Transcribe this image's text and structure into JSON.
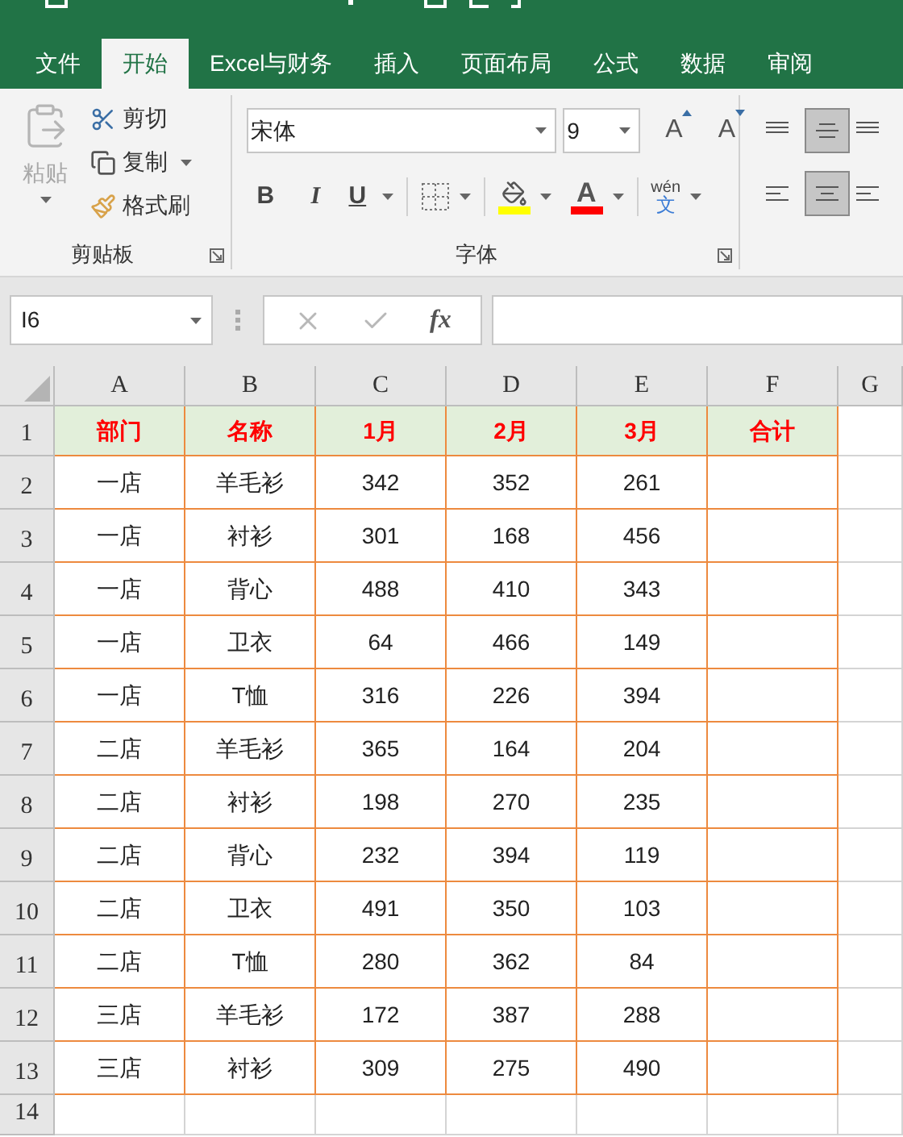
{
  "ribbon_tabs": [
    {
      "label": "文件",
      "selected": false
    },
    {
      "label": "开始",
      "selected": true
    },
    {
      "label": "Excel与财务",
      "selected": false
    },
    {
      "label": "插入",
      "selected": false
    },
    {
      "label": "页面布局",
      "selected": false
    },
    {
      "label": "公式",
      "selected": false
    },
    {
      "label": "数据",
      "selected": false
    },
    {
      "label": "审阅",
      "selected": false
    }
  ],
  "clipboard": {
    "paste": {
      "label": "粘贴",
      "disabled": true
    },
    "cut": "剪切",
    "copy": "复制",
    "format_painter": "格式刷",
    "group_label": "剪贴板"
  },
  "font": {
    "font_name": "宋体",
    "font_size": "9",
    "grow_font": "A",
    "shrink_font": "A",
    "bold": "B",
    "italic": "I",
    "underline": "U",
    "font_color": "A",
    "phonetic_pinyin": "wén",
    "phonetic_char": "文",
    "group_label": "字体"
  },
  "alignment": [
    {
      "kind": "top",
      "selected": false
    },
    {
      "kind": "middle",
      "selected": true
    },
    {
      "kind": "left",
      "selected": false
    },
    {
      "kind": "center",
      "selected": true
    }
  ],
  "formula_bar": {
    "name_box": "I6",
    "fx": "fx"
  },
  "sheet": {
    "columns": [
      "A",
      "B",
      "C",
      "D",
      "E",
      "F",
      "G"
    ],
    "rows": [
      {
        "number": "1",
        "kind": "header",
        "cells": [
          "部门",
          "名称",
          "1月",
          "2月",
          "3月",
          "合计"
        ]
      },
      {
        "number": "2",
        "kind": "data",
        "cells": [
          "一店",
          "羊毛衫",
          "342",
          "352",
          "261"
        ]
      },
      {
        "number": "3",
        "kind": "data",
        "cells": [
          "一店",
          "衬衫",
          "301",
          "168",
          "456"
        ]
      },
      {
        "number": "4",
        "kind": "data",
        "cells": [
          "一店",
          "背心",
          "488",
          "410",
          "343"
        ]
      },
      {
        "number": "5",
        "kind": "data",
        "cells": [
          "一店",
          "卫衣",
          "64",
          "466",
          "149"
        ]
      },
      {
        "number": "6",
        "kind": "data",
        "cells": [
          "一店",
          "T恤",
          "316",
          "226",
          "394"
        ]
      },
      {
        "number": "7",
        "kind": "data",
        "cells": [
          "二店",
          "羊毛衫",
          "365",
          "164",
          "204"
        ]
      },
      {
        "number": "8",
        "kind": "data",
        "cells": [
          "二店",
          "衬衫",
          "198",
          "270",
          "235"
        ]
      },
      {
        "number": "9",
        "kind": "data",
        "cells": [
          "二店",
          "背心",
          "232",
          "394",
          "119"
        ]
      },
      {
        "number": "10",
        "kind": "data",
        "cells": [
          "二店",
          "卫衣",
          "491",
          "350",
          "103"
        ]
      },
      {
        "number": "11",
        "kind": "data",
        "cells": [
          "二店",
          "T恤",
          "280",
          "362",
          "84"
        ]
      },
      {
        "number": "12",
        "kind": "data",
        "cells": [
          "三店",
          "羊毛衫",
          "172",
          "387",
          "288"
        ]
      },
      {
        "number": "13",
        "kind": "data",
        "cells": [
          "三店",
          "衬衫",
          "309",
          "275",
          "490"
        ]
      },
      {
        "number": "14",
        "kind": "empty"
      }
    ]
  }
}
